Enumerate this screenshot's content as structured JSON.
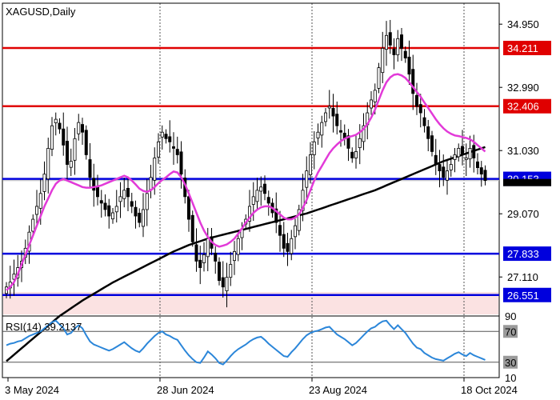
{
  "chart_data": {
    "type": "candlestick",
    "symbol": "XAGUSD",
    "timeframe": "Daily",
    "ylim": [
      25.9,
      35.6
    ],
    "price_ticks": [
      "34.950",
      "32.990",
      "31.030",
      "29.070",
      "27.110"
    ],
    "price_tick_values": [
      34.95,
      32.99,
      31.03,
      29.07,
      27.11
    ],
    "date_ticks": [
      "3 May 2024",
      "28 Jun 2024",
      "23 Aug 2024",
      "18 Oct 2024"
    ],
    "date_tick_index": [
      0,
      40,
      80,
      120
    ],
    "levels": [
      {
        "label": "34.211",
        "value": 34.211,
        "color": "#e00000"
      },
      {
        "label": "32.406",
        "value": 32.406,
        "color": "#e00000"
      },
      {
        "label": "30.153",
        "value": 30.153,
        "color": "#0000dd"
      },
      {
        "label": "27.833",
        "value": 27.833,
        "color": "#0000dd"
      },
      {
        "label": "26.551",
        "value": 26.551,
        "color": "#0000dd"
      }
    ],
    "close": [
      26.8,
      26.95,
      27.2,
      27.4,
      27.6,
      28.0,
      28.5,
      28.9,
      29.3,
      29.7,
      30.3,
      31.1,
      31.8,
      32.0,
      31.7,
      31.2,
      30.6,
      30.7,
      31.4,
      31.9,
      31.6,
      30.9,
      30.2,
      29.8,
      29.6,
      29.4,
      29.2,
      29.0,
      29.1,
      29.3,
      29.6,
      29.8,
      29.6,
      29.3,
      29.0,
      28.8,
      29.2,
      29.7,
      30.2,
      30.8,
      31.3,
      31.6,
      31.4,
      31.3,
      31.1,
      30.9,
      30.3,
      29.6,
      28.9,
      28.2,
      27.6,
      27.4,
      27.8,
      28.3,
      28.0,
      27.6,
      27.0,
      26.8,
      27.1,
      27.5,
      27.9,
      28.3,
      28.6,
      28.9,
      29.3,
      29.6,
      29.8,
      29.9,
      29.7,
      29.4,
      29.1,
      28.8,
      28.4,
      28.0,
      27.9,
      28.3,
      28.7,
      29.2,
      29.8,
      30.4,
      30.9,
      31.3,
      31.6,
      31.9,
      32.2,
      32.4,
      32.1,
      31.8,
      31.6,
      31.4,
      31.1,
      30.8,
      31.0,
      31.4,
      31.8,
      32.2,
      32.6,
      32.9,
      33.6,
      34.2,
      34.6,
      34.3,
      34.0,
      34.5,
      34.2,
      33.9,
      33.4,
      32.8,
      32.4,
      32.2,
      31.8,
      31.4,
      31.0,
      30.6,
      30.4,
      30.2,
      30.4,
      30.6,
      30.9,
      31.1,
      30.9,
      30.8,
      31.1,
      30.8,
      30.5,
      30.3,
      30.1
    ],
    "ma_pink": [
      26.7,
      26.8,
      26.95,
      27.2,
      27.5,
      27.8,
      28.1,
      28.4,
      28.7,
      29.0,
      29.3,
      29.55,
      29.8,
      30.0,
      30.1,
      30.15,
      30.1,
      30.05,
      30.0,
      29.95,
      29.9,
      29.88,
      29.88,
      29.9,
      29.92,
      29.95,
      30.0,
      30.05,
      30.1,
      30.15,
      30.2,
      30.25,
      30.2,
      30.1,
      29.98,
      29.85,
      29.78,
      29.75,
      29.8,
      29.9,
      30.02,
      30.12,
      30.2,
      30.3,
      30.38,
      30.35,
      30.2,
      29.98,
      29.7,
      29.4,
      29.1,
      28.8,
      28.55,
      28.35,
      28.2,
      28.1,
      28.05,
      28.08,
      28.12,
      28.2,
      28.3,
      28.45,
      28.62,
      28.8,
      28.95,
      29.1,
      29.2,
      29.27,
      29.3,
      29.3,
      29.25,
      29.15,
      29.05,
      28.95,
      28.9,
      28.9,
      28.95,
      29.05,
      29.25,
      29.5,
      29.8,
      30.1,
      30.35,
      30.55,
      30.75,
      30.95,
      31.1,
      31.22,
      31.32,
      31.4,
      31.45,
      31.48,
      31.52,
      31.6,
      31.7,
      31.85,
      32.05,
      32.3,
      32.6,
      32.9,
      33.15,
      33.3,
      33.38,
      33.4,
      33.36,
      33.28,
      33.15,
      33.0,
      32.85,
      32.7,
      32.52,
      32.35,
      32.18,
      32.0,
      31.85,
      31.72,
      31.62,
      31.55,
      31.5,
      31.48,
      31.45,
      31.42,
      31.38,
      31.3,
      31.2,
      31.1,
      31.0
    ],
    "ma_black": [
      24.5,
      24.6,
      24.7,
      24.8,
      24.9,
      25.0,
      25.1,
      25.2,
      25.3,
      25.4,
      25.5,
      25.6,
      25.7,
      25.8,
      25.9,
      25.98,
      26.06,
      26.14,
      26.22,
      26.3,
      26.38,
      26.45,
      26.52,
      26.59,
      26.66,
      26.73,
      26.8,
      26.87,
      26.94,
      27.0,
      27.06,
      27.12,
      27.18,
      27.24,
      27.3,
      27.36,
      27.42,
      27.48,
      27.54,
      27.6,
      27.66,
      27.72,
      27.78,
      27.84,
      27.9,
      27.95,
      28.0,
      28.05,
      28.1,
      28.14,
      28.18,
      28.22,
      28.26,
      28.3,
      28.33,
      28.36,
      28.39,
      28.42,
      28.45,
      28.48,
      28.51,
      28.54,
      28.57,
      28.6,
      28.63,
      28.66,
      28.69,
      28.72,
      28.75,
      28.78,
      28.81,
      28.84,
      28.87,
      28.9,
      28.93,
      28.96,
      28.99,
      29.02,
      29.05,
      29.08,
      29.12,
      29.16,
      29.2,
      29.24,
      29.28,
      29.32,
      29.36,
      29.4,
      29.44,
      29.48,
      29.52,
      29.56,
      29.6,
      29.64,
      29.68,
      29.72,
      29.76,
      29.8,
      29.85,
      29.9,
      29.95,
      30.0,
      30.05,
      30.1,
      30.15,
      30.2,
      30.25,
      30.3,
      30.35,
      30.4,
      30.45,
      30.5,
      30.55,
      30.6,
      30.65,
      30.7,
      30.74,
      30.78,
      30.82,
      30.86,
      30.9,
      30.94,
      30.98,
      31.02,
      31.06,
      31.1,
      31.14
    ],
    "rsi": {
      "label": "RSI(14) 39.2137",
      "value": 39.2137,
      "levels": [
        30,
        70
      ],
      "ticks": [
        "90",
        "70",
        "30",
        "10"
      ],
      "tick_values": [
        90,
        70,
        30,
        10
      ],
      "ylim": [
        10,
        90
      ],
      "values": [
        52,
        54,
        55,
        57,
        58,
        61,
        64,
        66,
        68,
        70,
        74,
        78,
        82,
        84,
        79,
        74,
        66,
        68,
        74,
        78,
        74,
        65,
        57,
        53,
        51,
        49,
        47,
        45,
        47,
        50,
        53,
        56,
        52,
        48,
        45,
        43,
        48,
        54,
        59,
        64,
        68,
        70,
        66,
        64,
        61,
        59,
        52,
        45,
        39,
        34,
        30,
        29,
        36,
        44,
        40,
        35,
        29,
        27,
        32,
        38,
        43,
        47,
        50,
        53,
        57,
        60,
        62,
        63,
        59,
        54,
        50,
        46,
        42,
        38,
        37,
        43,
        48,
        54,
        60,
        65,
        68,
        70,
        71,
        73,
        75,
        76,
        71,
        66,
        63,
        60,
        56,
        52,
        55,
        60,
        65,
        70,
        74,
        76,
        80,
        83,
        84,
        78,
        73,
        78,
        73,
        68,
        61,
        54,
        49,
        47,
        42,
        39,
        36,
        34,
        33,
        32,
        35,
        38,
        41,
        43,
        40,
        38,
        42,
        39,
        37,
        35,
        33
      ]
    }
  }
}
